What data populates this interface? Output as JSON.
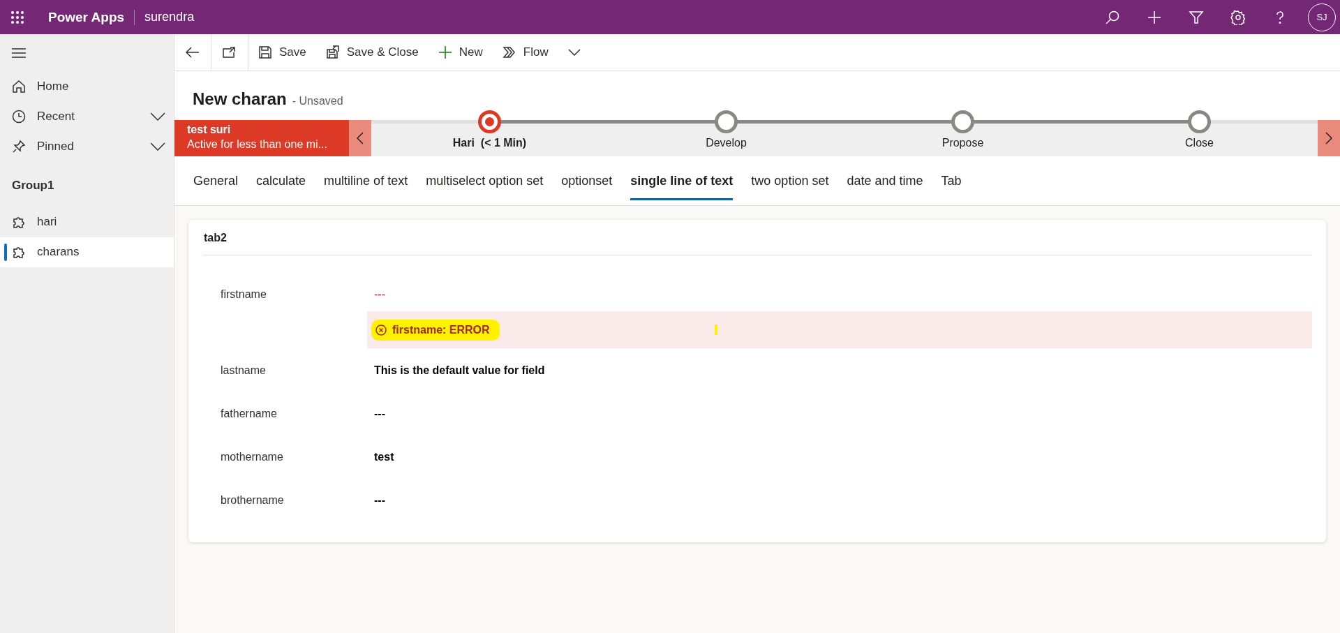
{
  "app_bar": {
    "app_name": "Power Apps",
    "environment": "surendra",
    "avatar": "SJ"
  },
  "sidebar": {
    "nav": [
      {
        "label": "Home",
        "kind": "link"
      },
      {
        "label": "Recent",
        "kind": "group",
        "expanded": false
      },
      {
        "label": "Pinned",
        "kind": "group",
        "expanded": false
      }
    ],
    "group_title": "Group1",
    "items": [
      {
        "label": "hari",
        "selected": false
      },
      {
        "label": "charans",
        "selected": true
      }
    ]
  },
  "command_bar": {
    "buttons": [
      {
        "label": "Save",
        "kind": "save"
      },
      {
        "label": "Save & Close",
        "kind": "save-close"
      },
      {
        "label": "New",
        "kind": "new"
      },
      {
        "label": "Flow",
        "kind": "flow"
      }
    ]
  },
  "record": {
    "title": "New charan",
    "status": "- Unsaved"
  },
  "process": {
    "name": "test suri",
    "duration": "Active for less than one mi...",
    "stages": [
      {
        "label": "Hari  (< 1 Min)",
        "selected": true
      },
      {
        "label": "Develop",
        "selected": false
      },
      {
        "label": "Propose",
        "selected": false
      },
      {
        "label": "Close",
        "selected": false
      }
    ]
  },
  "tabs": [
    {
      "label": "General",
      "selected": false
    },
    {
      "label": "calculate",
      "selected": false
    },
    {
      "label": "multiline of text",
      "selected": false
    },
    {
      "label": "multiselect option set",
      "selected": false
    },
    {
      "label": "optionset",
      "selected": false
    },
    {
      "label": "single line of text",
      "selected": true
    },
    {
      "label": "two option set",
      "selected": false
    },
    {
      "label": "date and time",
      "selected": false
    },
    {
      "label": "Tab",
      "selected": false
    }
  ],
  "section": {
    "title": "tab2",
    "fields": [
      {
        "label": "firstname",
        "value": "---",
        "error": "firstname: ERROR"
      },
      {
        "label": "lastname",
        "value": "This is the default value for field"
      },
      {
        "label": "fathername",
        "value": "---"
      },
      {
        "label": "mothername",
        "value": "test"
      },
      {
        "label": "brothername",
        "value": "---"
      }
    ]
  }
}
